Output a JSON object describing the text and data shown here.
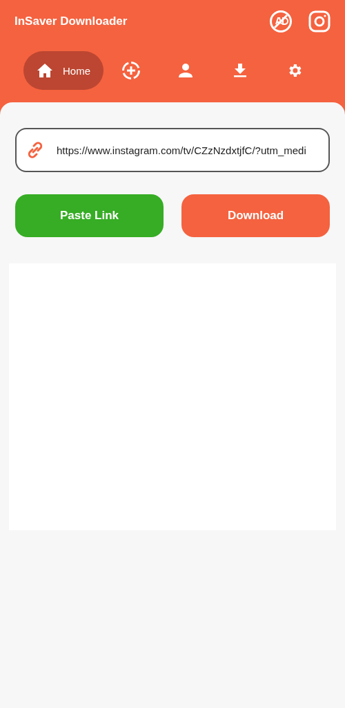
{
  "app_bar": {
    "title": "InSaver Downloader"
  },
  "tabs": [
    {
      "kind": "home",
      "label": "Home",
      "selected": true
    },
    {
      "kind": "add",
      "selected": false
    },
    {
      "kind": "person",
      "selected": false
    },
    {
      "kind": "download",
      "selected": false
    },
    {
      "kind": "settings",
      "selected": false
    }
  ],
  "link_field": {
    "value": "https://www.instagram.com/tv/CZzNzdxtjfC/?utm_medi"
  },
  "buttons": [
    {
      "kind": "paste",
      "label": "Paste Link"
    },
    {
      "kind": "download",
      "label": "Download"
    }
  ],
  "preview": {
    "kind": "empty"
  }
}
